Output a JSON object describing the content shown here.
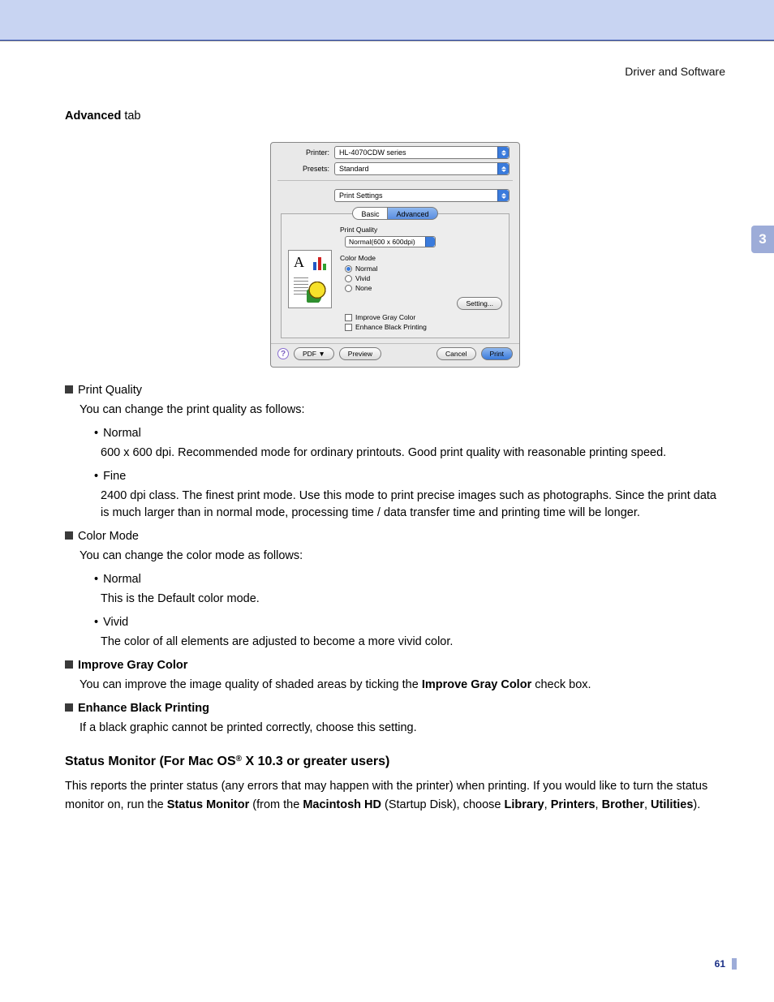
{
  "header": {
    "right": "Driver and Software"
  },
  "chapter": "3",
  "page_number": "61",
  "section": {
    "bold": "Advanced",
    "rest": " tab"
  },
  "dialog": {
    "printer_label": "Printer:",
    "printer_value": "HL-4070CDW series",
    "presets_label": "Presets:",
    "presets_value": "Standard",
    "pane_value": "Print Settings",
    "tabs": {
      "basic": "Basic",
      "advanced": "Advanced"
    },
    "pq_label": "Print Quality",
    "pq_value": "Normal(600 x 600dpi)",
    "cm_label": "Color Mode",
    "cm_options": [
      "Normal",
      "Vivid",
      "None"
    ],
    "cm_selected": 0,
    "setting_btn": "Setting...",
    "chk_gray": "Improve Gray Color",
    "chk_black": "Enhance Black Printing",
    "footer": {
      "help": "?",
      "pdf": "PDF ▼",
      "preview": "Preview",
      "cancel": "Cancel",
      "print": "Print"
    }
  },
  "body": {
    "pq_title": "Print Quality",
    "pq_intro": "You can change the print quality as follows:",
    "pq_items": [
      {
        "name": "Normal",
        "desc": "600 x 600 dpi. Recommended mode for ordinary printouts. Good print quality with reasonable printing speed."
      },
      {
        "name": "Fine",
        "desc": "2400 dpi class. The finest print mode. Use this mode to print precise images such as photographs. Since the print data is much larger than in normal mode, processing time / data transfer time and printing time will be longer."
      }
    ],
    "cm_title": "Color Mode",
    "cm_intro": "You can change the color mode as follows:",
    "cm_items": [
      {
        "name": "Normal",
        "desc": "This is the Default color mode."
      },
      {
        "name": "Vivid",
        "desc": "The color of all elements are adjusted to become a more vivid color."
      }
    ],
    "gray_title": "Improve Gray Color",
    "gray_desc_pre": "You can improve the image quality of shaded areas by ticking the ",
    "gray_desc_bold": "Improve Gray Color",
    "gray_desc_post": " check box.",
    "black_title": "Enhance Black Printing",
    "black_desc": "If a black graphic cannot be printed correctly, choose this setting.",
    "status_h_pre": "Status Monitor (For Mac OS",
    "status_h_sup": "®",
    "status_h_post": " X 10.3 or greater users)",
    "status_body_1": "This reports the printer status (any errors that may happen with the printer) when printing. If you would like to turn the status monitor on, run the ",
    "status_bold_1": "Status Monitor",
    "status_body_2": " (from the ",
    "status_bold_2": "Macintosh HD",
    "status_body_3": " (Startup Disk), choose ",
    "status_bold_3": "Library",
    "status_body_4": ", ",
    "status_bold_4": "Printers",
    "status_body_5": ", ",
    "status_bold_5": "Brother",
    "status_body_6": ", ",
    "status_bold_6": "Utilities",
    "status_body_7": ")."
  }
}
